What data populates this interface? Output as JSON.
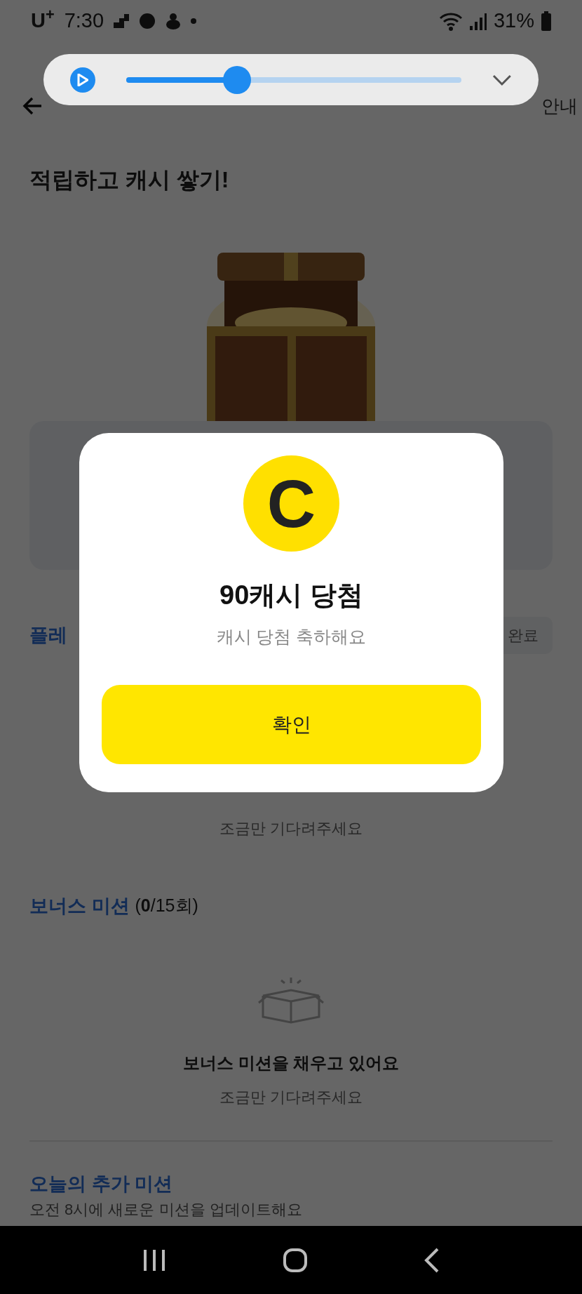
{
  "status_bar": {
    "carrier": "U$^{+}$",
    "time": "7:30",
    "battery": "31%"
  },
  "media_player": {
    "level": 0.33
  },
  "header": {
    "action": "안내"
  },
  "headline": "적립하고 캐시 쌓기!",
  "place_mission": {
    "title": "플레",
    "chip": "완료",
    "empty_subtitle": "조금만 기다려주세요"
  },
  "bonus_mission": {
    "title": "보너스 미션",
    "count": "(**0**/15회)",
    "empty_title": "보너스 미션을 채우고 있어요",
    "empty_subtitle": "조금만 기다려주세요"
  },
  "extra_mission": {
    "title": "오늘의 추가 미션",
    "subtitle": "오전 8시에 새로운 미션을 업데이트해요"
  },
  "dialog": {
    "coin_letter": "C",
    "title": "90캐시 당첨",
    "message": "캐시 당첨 축하해요",
    "button": "확인"
  }
}
